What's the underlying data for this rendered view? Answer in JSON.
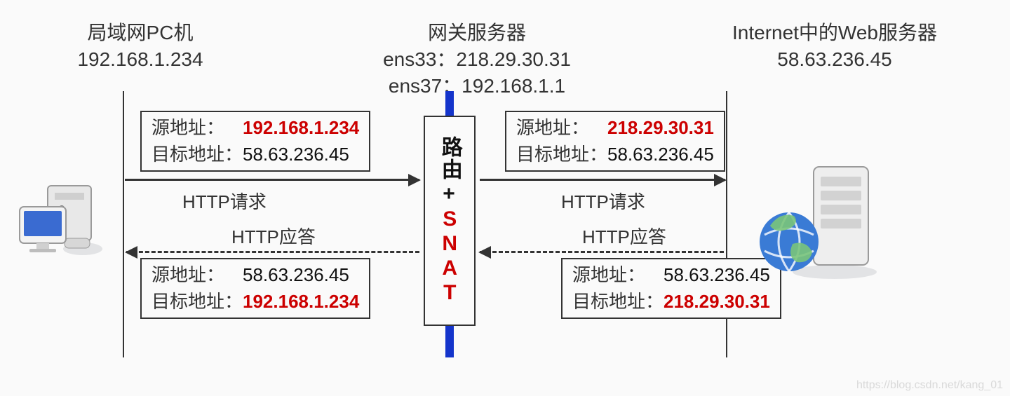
{
  "left_node": {
    "title": "局域网PC机",
    "ip": "192.168.1.234"
  },
  "mid_node": {
    "title": "网关服务器",
    "if1": "ens33：218.29.30.31",
    "if2": "ens37：192.168.1.1"
  },
  "right_node": {
    "title": "Internet中的Web服务器",
    "ip": "58.63.236.45"
  },
  "center_box": {
    "top": "路由",
    "plus": "+",
    "bottom": "SNAT"
  },
  "labels": {
    "src": "源地址：",
    "dst": "目标地址：",
    "req": "HTTP请求",
    "resp": "HTTP应答"
  },
  "pkt_req_left": {
    "src": "192.168.1.234",
    "dst": "58.63.236.45",
    "src_hl": true,
    "dst_hl": false
  },
  "pkt_req_right": {
    "src": "218.29.30.31",
    "dst": "58.63.236.45",
    "src_hl": true,
    "dst_hl": false
  },
  "pkt_resp_left": {
    "src": "58.63.236.45",
    "dst": "192.168.1.234",
    "src_hl": false,
    "dst_hl": true
  },
  "pkt_resp_right": {
    "src": "58.63.236.45",
    "dst": "218.29.30.31",
    "src_hl": false,
    "dst_hl": true
  },
  "watermark": "https://blog.csdn.net/kang_01"
}
